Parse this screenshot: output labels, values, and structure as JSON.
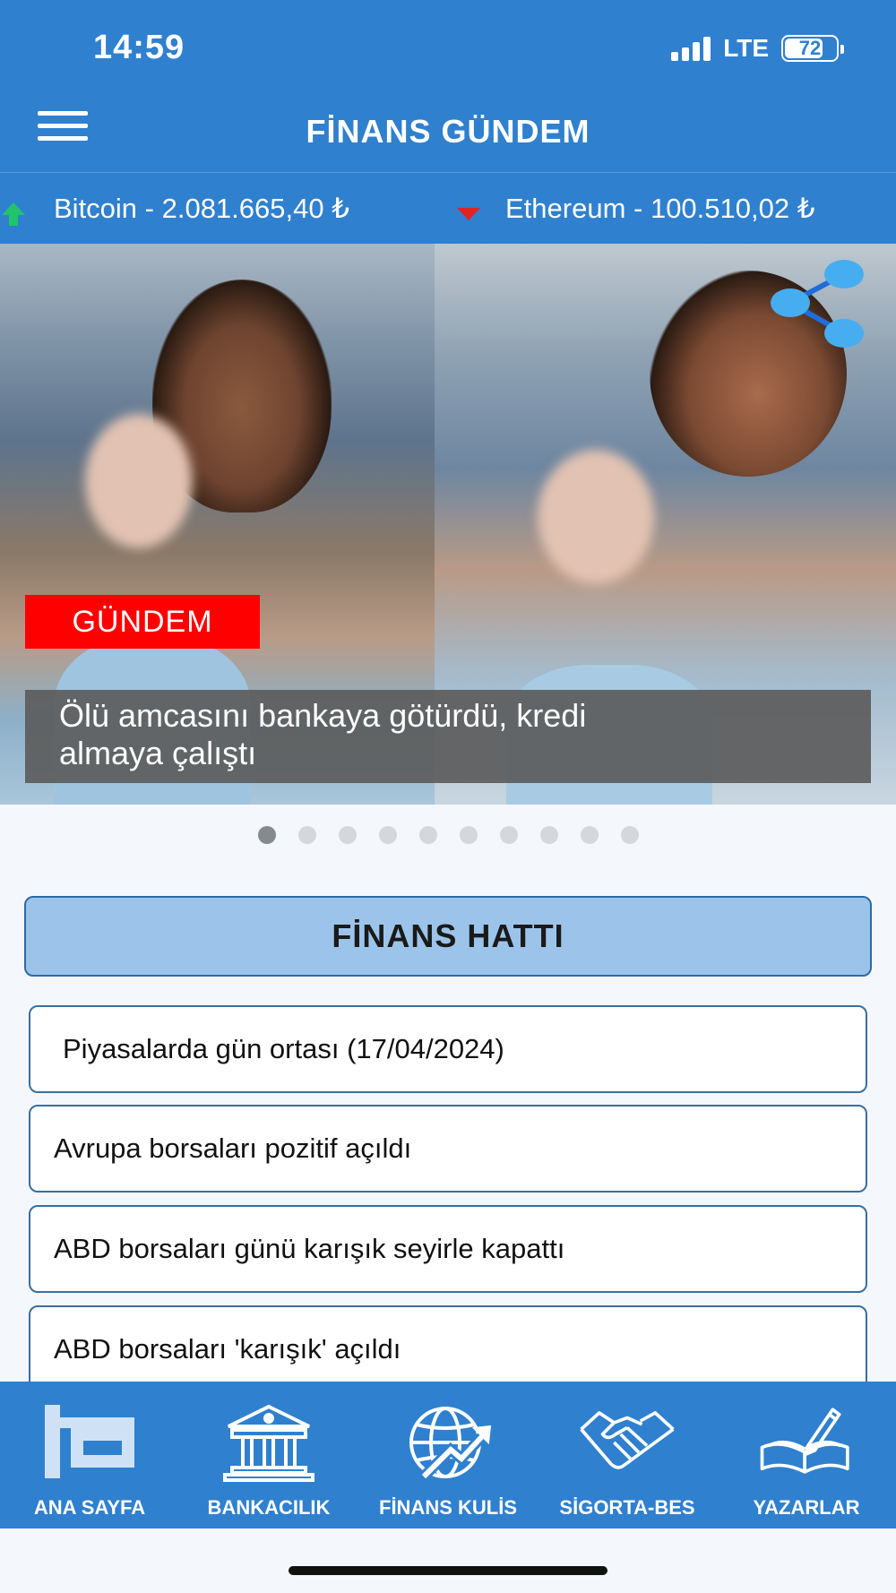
{
  "status_bar": {
    "time": "14:59",
    "network": "LTE",
    "battery": "72"
  },
  "header": {
    "title": "FİNANS GÜNDEM",
    "menu_icon": "hamburger-menu-icon"
  },
  "ticker": {
    "items": [
      {
        "label": "Bitcoin - 2.081.665,40 ₺",
        "trend": "up",
        "color": "#21c36b"
      },
      {
        "label": "Ethereum - 100.510,02 ₺",
        "trend": "down",
        "color": "#e02424"
      }
    ]
  },
  "hero": {
    "category": "GÜNDEM",
    "headline_line1": "Ölü amcasını bankaya götürdü, kredi",
    "headline_line2": "almaya çalıştı",
    "share_icon": "share-icon",
    "slide_count": 10,
    "active_slide": 1
  },
  "section": {
    "title": "FİNANS HATTI",
    "items": [
      "Piyasalarda gün ortası (17/04/2024)",
      "Avrupa borsaları pozitif açıldı",
      "ABD borsaları günü karışık seyirle kapattı",
      "ABD borsaları 'karışık' açıldı"
    ]
  },
  "bottom_nav": {
    "items": [
      {
        "label": "ANA SAYFA",
        "icon": "fg-logo-icon"
      },
      {
        "label": "BANKACILIK",
        "icon": "bank-icon"
      },
      {
        "label": "FİNANS KULİS",
        "icon": "globe-chart-icon"
      },
      {
        "label": "SİGORTA-BES",
        "icon": "handshake-icon"
      },
      {
        "label": "YAZARLAR",
        "icon": "book-pen-icon"
      }
    ]
  },
  "colors": {
    "primary": "#2f80cf",
    "badge": "#ff0000",
    "section_head": "#9cc4ea"
  }
}
